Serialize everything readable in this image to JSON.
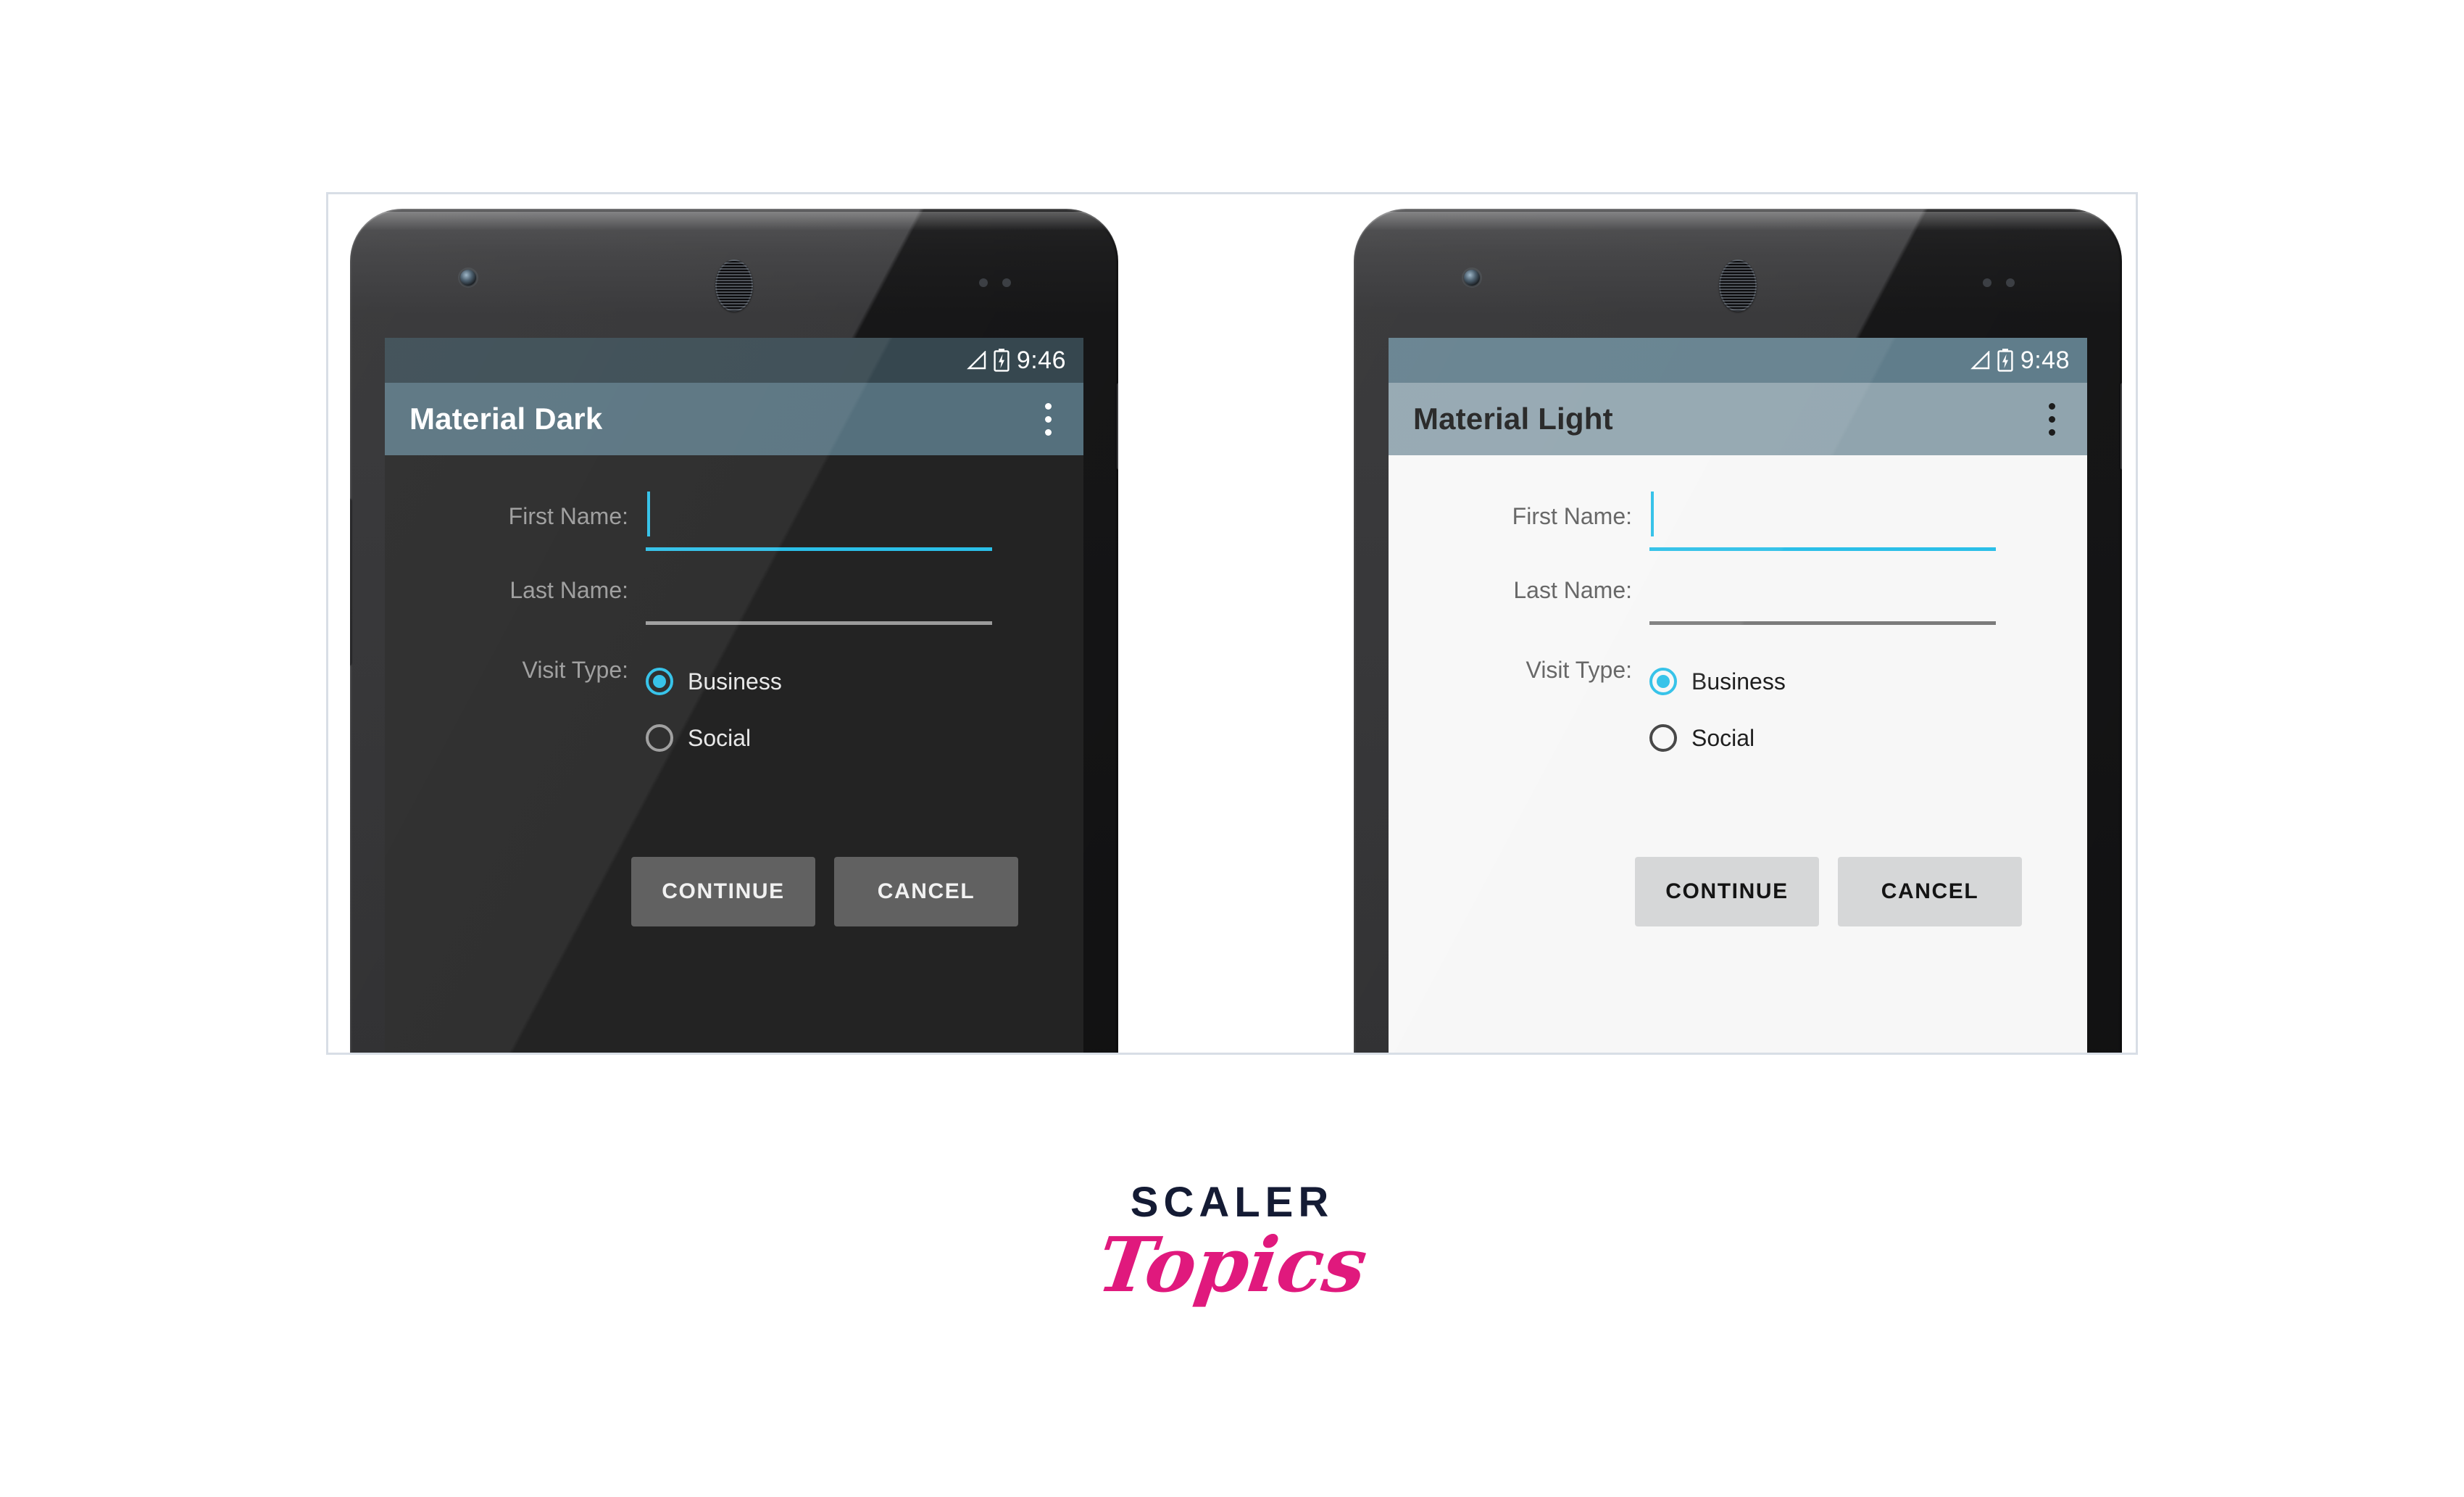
{
  "figure": {
    "caption_present": false
  },
  "brand": {
    "line1": "SCALER",
    "line2": "Topics",
    "color_dark": "#141b34",
    "color_pink": "#e0197d"
  },
  "accent_color": "#2bbfe8",
  "phones": [
    {
      "id": "material-dark",
      "theme": "dark",
      "status_bar": {
        "time": "9:46",
        "signal_icon": "signal-triangle-icon",
        "battery_icon": "battery-charging-icon",
        "background": "#36474f"
      },
      "app_bar": {
        "title": "Material Dark",
        "background": "#55707d",
        "title_color": "#ffffff",
        "overflow_icon": "more-vert-icon"
      },
      "screen_background": "#232323",
      "form": {
        "fields": [
          {
            "label": "First Name:",
            "value": "",
            "focused": true,
            "underline_color": "#2bbfe8"
          },
          {
            "label": "Last Name:",
            "value": "",
            "focused": false,
            "underline_color": "#9b9b9b"
          }
        ],
        "radio_group": {
          "label": "Visit Type:",
          "options": [
            {
              "label": "Business",
              "checked": true
            },
            {
              "label": "Social",
              "checked": false
            }
          ]
        },
        "buttons": [
          {
            "label": "CONTINUE"
          },
          {
            "label": "CANCEL"
          }
        ]
      }
    },
    {
      "id": "material-light",
      "theme": "light",
      "status_bar": {
        "time": "9:48",
        "signal_icon": "signal-triangle-icon",
        "battery_icon": "battery-charging-icon",
        "background": "#607d8b"
      },
      "app_bar": {
        "title": "Material Light",
        "background": "#90a4ae",
        "title_color": "#1c1c1c",
        "overflow_icon": "more-vert-icon"
      },
      "screen_background": "#f7f7f7",
      "form": {
        "fields": [
          {
            "label": "First Name:",
            "value": "",
            "focused": true,
            "underline_color": "#2bbfe8"
          },
          {
            "label": "Last Name:",
            "value": "",
            "focused": false,
            "underline_color": "#7b7b7b"
          }
        ],
        "radio_group": {
          "label": "Visit Type:",
          "options": [
            {
              "label": "Business",
              "checked": true
            },
            {
              "label": "Social",
              "checked": false
            }
          ]
        },
        "buttons": [
          {
            "label": "CONTINUE"
          },
          {
            "label": "CANCEL"
          }
        ]
      }
    }
  ]
}
